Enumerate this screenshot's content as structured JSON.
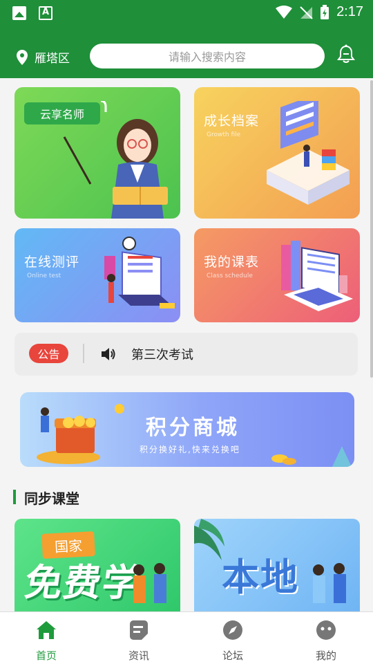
{
  "status_bar": {
    "time": "2:17"
  },
  "header": {
    "location": "雁塔区",
    "search_placeholder": "请输入搜索内容"
  },
  "cards": [
    {
      "title": "云享名师",
      "subtitle": ""
    },
    {
      "title": "成长档案",
      "subtitle": "Growth file"
    },
    {
      "title": "在线测评",
      "subtitle": "Online test"
    },
    {
      "title": "我的课表",
      "subtitle": "Class schedule"
    }
  ],
  "notice": {
    "badge": "公告",
    "text": "第三次考试"
  },
  "banner": {
    "title": "积分商城",
    "subtitle": "积分换好礼,快来兑换吧"
  },
  "section": {
    "title": "同步课堂"
  },
  "courses": [
    {
      "tag": "国家",
      "big_text": "免费学"
    },
    {
      "big_text": "本地"
    }
  ],
  "bottom_nav": [
    {
      "label": "首页",
      "active": true
    },
    {
      "label": "资讯",
      "active": false
    },
    {
      "label": "论坛",
      "active": false
    },
    {
      "label": "我的",
      "active": false
    }
  ],
  "colors": {
    "primary": "#1f8f3a",
    "notice_badge": "#e8453c",
    "accent_green": "#1f9b3c"
  }
}
